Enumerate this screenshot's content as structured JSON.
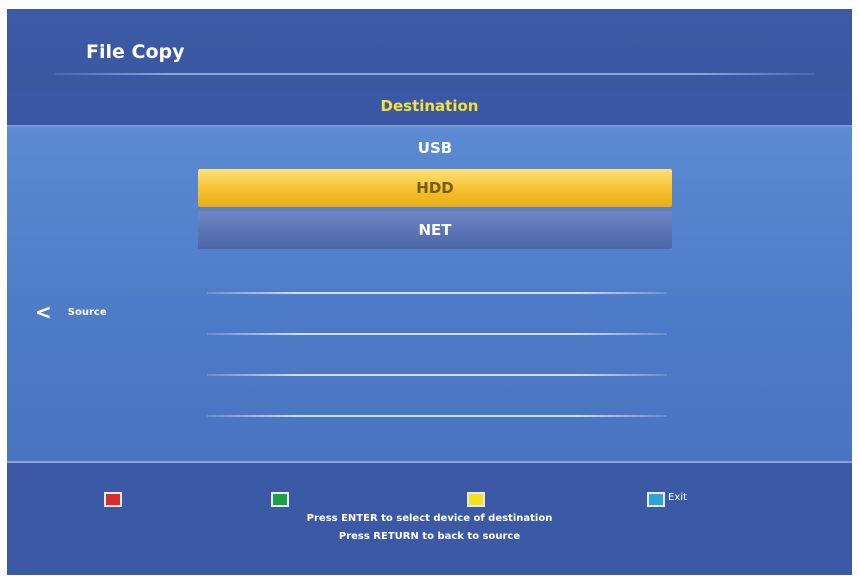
{
  "header": {
    "title": "File Copy"
  },
  "destination": {
    "label": "Destination",
    "items": [
      {
        "label": "USB",
        "state": "normal"
      },
      {
        "label": "HDD",
        "state": "selected"
      },
      {
        "label": "NET",
        "state": "highlighted"
      }
    ]
  },
  "side_nav": {
    "source_label": "Source",
    "icon": "chevron-left-icon"
  },
  "footer": {
    "keys": [
      {
        "color": "#d82c2c",
        "icon": "red-key-icon",
        "label": ""
      },
      {
        "color": "#1aa047",
        "icon": "green-key-icon",
        "label": ""
      },
      {
        "color": "#f3e21a",
        "icon": "yellow-key-icon",
        "label": ""
      },
      {
        "color": "#2aa5d6",
        "icon": "blue-key-icon",
        "label": "Exit"
      }
    ],
    "hint_line_1": "Press ENTER to select device of destination",
    "hint_line_2": "Press RETURN to back to source"
  },
  "colors": {
    "background": "#3c5aa3",
    "body": "#5b8bd2",
    "highlight": "#f4c12e",
    "title_accent": "#f2e23a"
  }
}
